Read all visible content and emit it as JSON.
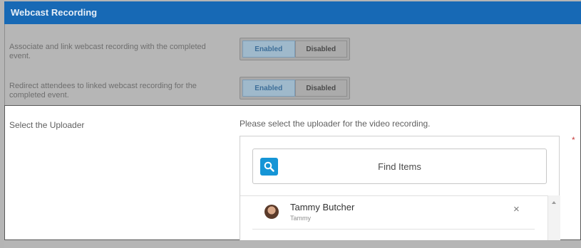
{
  "header": {
    "title": "Webcast Recording"
  },
  "settings": [
    {
      "label": "Associate and link webcast recording with the completed event.",
      "enabled_label": "Enabled",
      "disabled_label": "Disabled",
      "selected": "Enabled"
    },
    {
      "label": "Redirect attendees to linked webcast recording for the completed event.",
      "enabled_label": "Enabled",
      "disabled_label": "Disabled",
      "selected": "Enabled"
    }
  ],
  "uploader": {
    "label": "Select the Uploader",
    "help_text": "Please select the uploader for the video recording.",
    "required_mark": "*",
    "search_placeholder": "Find Items",
    "search_icon": "search-icon",
    "selected_items": [
      {
        "name": "Tammy Butcher",
        "subtitle": "Tammy",
        "remove_glyph": "×"
      }
    ]
  },
  "colors": {
    "header_bg": "#1769b5",
    "accent": "#1595d6",
    "required": "#c73b3b"
  }
}
